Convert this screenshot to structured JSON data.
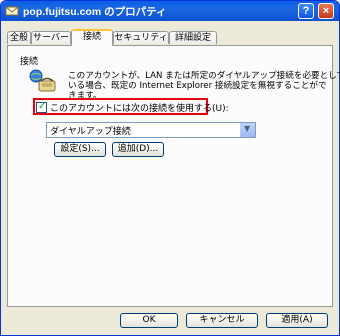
{
  "window": {
    "title": "pop.fujitsu.com のプロパティ",
    "help_button": "?",
    "close_button": "×"
  },
  "tabs": [
    {
      "label": "全般"
    },
    {
      "label": "サーバー"
    },
    {
      "label": "接続"
    },
    {
      "label": "セキュリティ"
    },
    {
      "label": "詳細設定"
    }
  ],
  "connection": {
    "group_label": "接続",
    "description_lines": [
      "このアカウントが、LAN または所定のダイヤルアップ接続を必要として",
      "いる場合、既定の Internet Explorer 接続設定を無視することがで",
      "きます。"
    ],
    "checkbox_label": "このアカウントには次の接続を使用する(U):",
    "checkbox_checked": true,
    "dropdown_value": "ダイヤルアップ接続",
    "settings_button": "設定(S)...",
    "add_button": "追加(D)..."
  },
  "footer": {
    "ok": "OK",
    "cancel": "キャンセル",
    "apply": "適用(A)"
  },
  "colors": {
    "titlebar": "#0a5fe8",
    "highlight_border": "#e8000c",
    "active_tab_accent": "#ffc83c"
  }
}
